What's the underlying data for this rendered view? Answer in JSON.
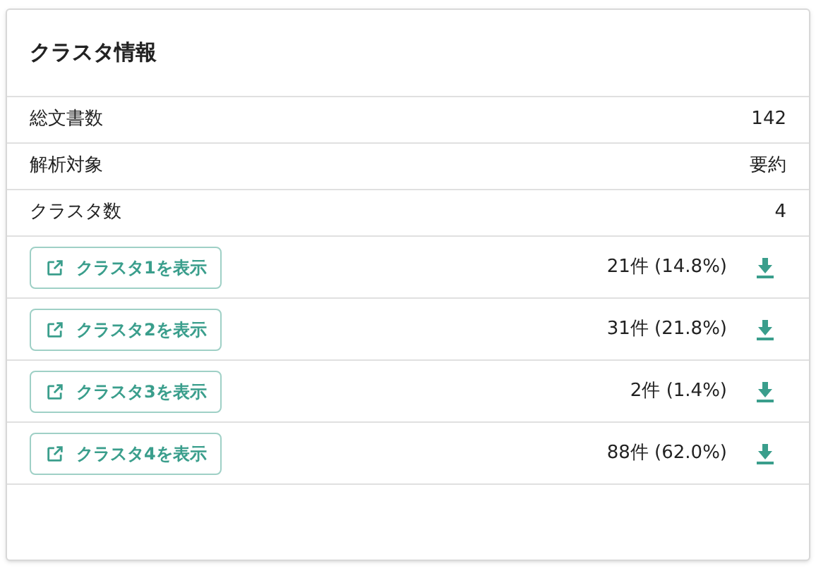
{
  "card": {
    "title": "クラスタ情報"
  },
  "info_rows": [
    {
      "label": "総文書数",
      "value": "142"
    },
    {
      "label": "解析対象",
      "value": "要約"
    },
    {
      "label": "クラスタ数",
      "value": "4"
    }
  ],
  "clusters": [
    {
      "button": "クラスタ1を表示",
      "count": "21件 (14.8%)"
    },
    {
      "button": "クラスタ2を表示",
      "count": "31件 (21.8%)"
    },
    {
      "button": "クラスタ3を表示",
      "count": "2件 (1.4%)"
    },
    {
      "button": "クラスタ4を表示",
      "count": "88件 (62.0%)"
    }
  ]
}
